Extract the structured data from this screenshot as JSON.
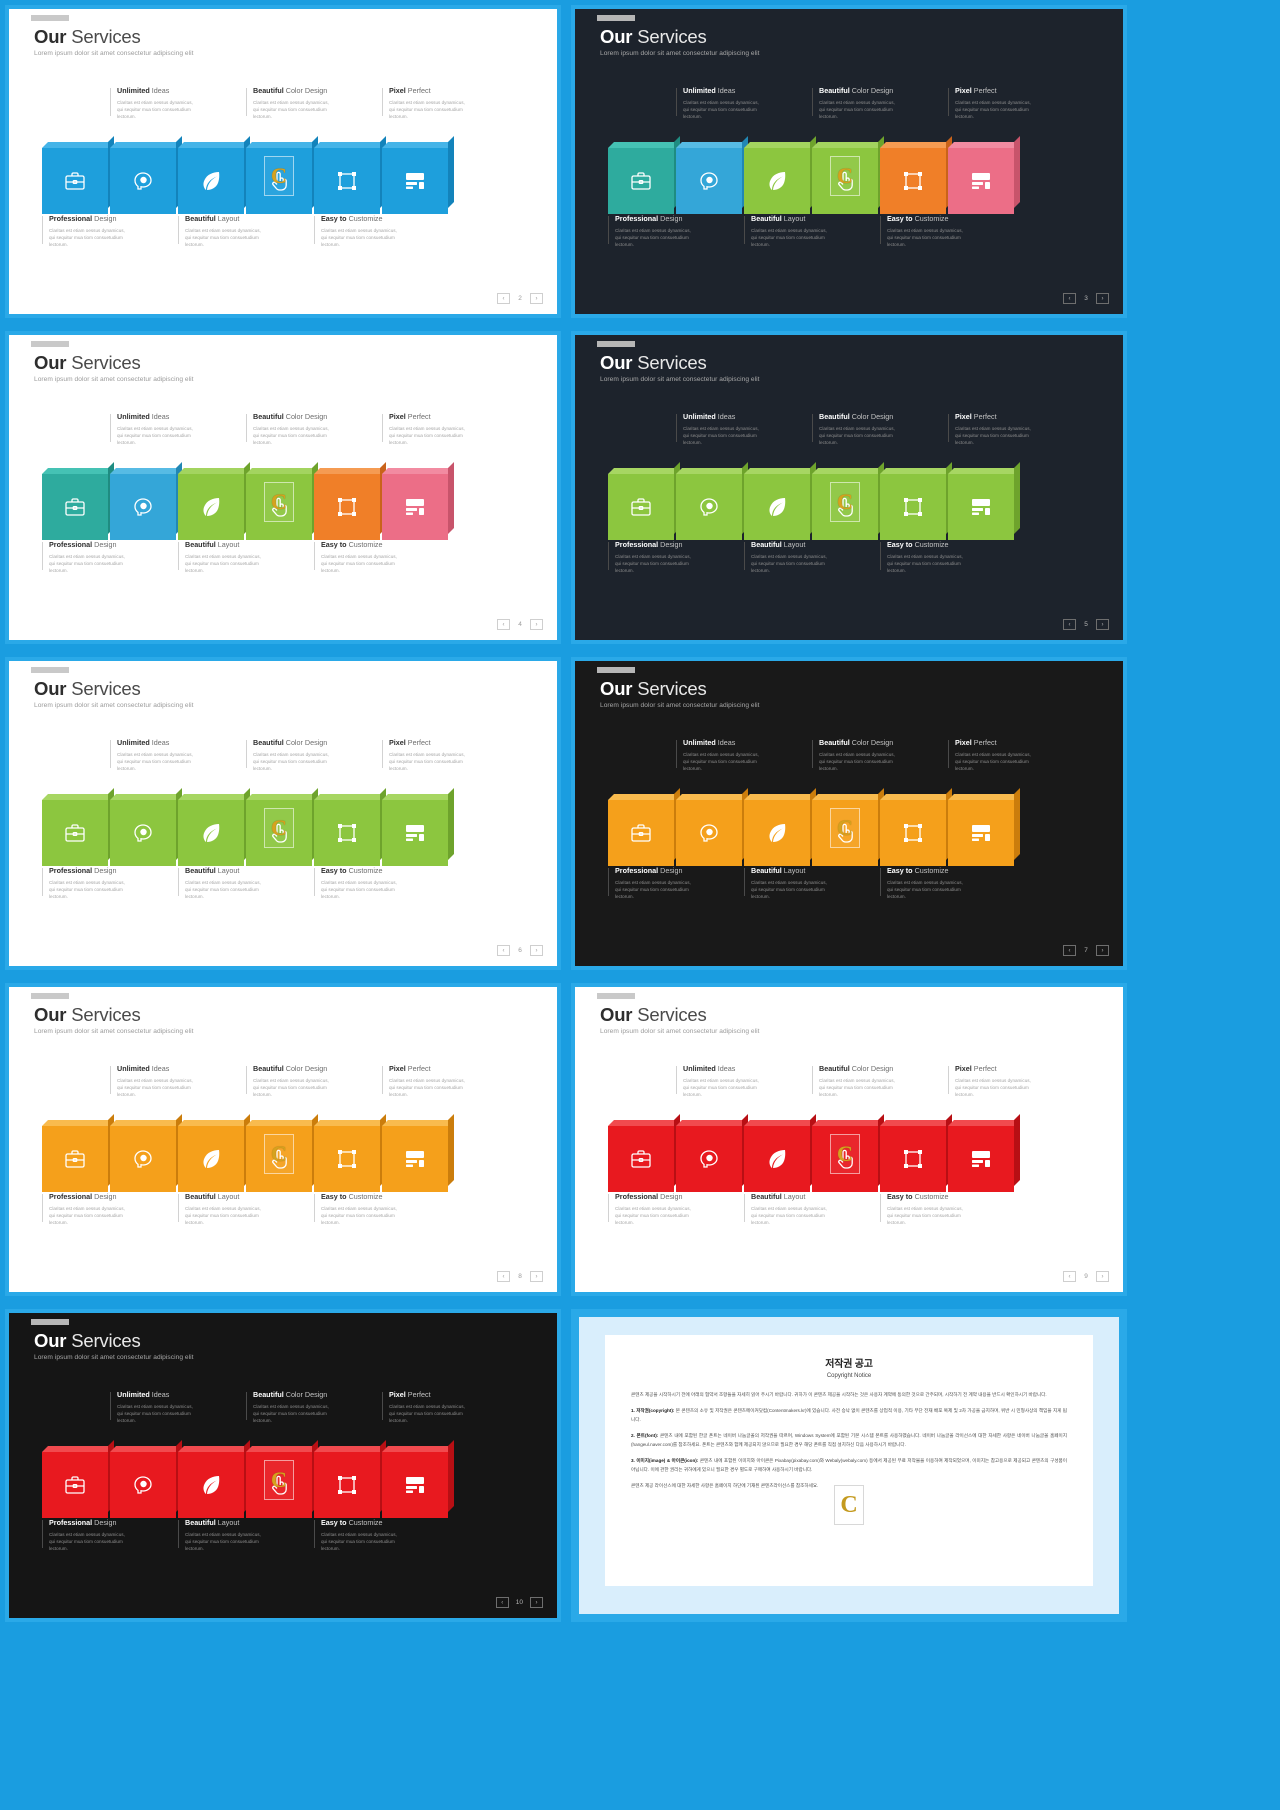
{
  "deck": {
    "title_bold": "Our",
    "title_rest": " Services",
    "subtitle": "Lorem ipsum dolor sit amet consectetur adipiscing elit",
    "body_text": "Claritas est etiam oessus dynamicus, qui sequitur mua tiom consuetudium lectorum.",
    "accent_frame": "#2aa9e8"
  },
  "labels": {
    "top": [
      {
        "bold": "Unlimited",
        "rest": " Ideas"
      },
      {
        "bold": "Beautiful",
        "rest": " Color Design"
      },
      {
        "bold": "Pixel",
        "rest": " Perfect"
      }
    ],
    "bottom": [
      {
        "bold": "Professional",
        "rest": " Design"
      },
      {
        "bold": "Beautiful",
        "rest": " Layout"
      },
      {
        "bold": "Easy to",
        "rest": " Customize"
      }
    ]
  },
  "icons": [
    "briefcase-icon",
    "head-bulb-icon",
    "leaf-icon",
    "hand-tap-icon",
    "crop-frame-icon",
    "server-icon"
  ],
  "watermark": {
    "letter": "C",
    "on_cube_index": 3
  },
  "pager": {
    "prev": "‹",
    "next": "›"
  },
  "slides": [
    {
      "name": "slide-blue-light",
      "theme": "light",
      "page": "2",
      "cube_colors": [
        "#1e9fdc",
        "#1e9fdc",
        "#1e9fdc",
        "#1e9fdc",
        "#1e9fdc",
        "#1e9fdc"
      ],
      "cube_tops": [
        "#45b4e8",
        "#45b4e8",
        "#45b4e8",
        "#45b4e8",
        "#45b4e8",
        "#45b4e8"
      ],
      "cube_sides": [
        "#1383bb",
        "#1383bb",
        "#1383bb",
        "#1383bb",
        "#1383bb",
        "#1383bb"
      ]
    },
    {
      "name": "slide-multicolor-dark",
      "theme": "dark",
      "page": "3",
      "cube_colors": [
        "#2eab9e",
        "#34a6d8",
        "#8cc63f",
        "#8cc63f",
        "#f07f28",
        "#ec6e87"
      ],
      "cube_tops": [
        "#45c2b4",
        "#57bbe4",
        "#a3d45f",
        "#a3d45f",
        "#f59b52",
        "#f28ba1"
      ],
      "cube_sides": [
        "#1f8c81",
        "#2287b4",
        "#6ea32c",
        "#6ea32c",
        "#c9631a",
        "#c8546b"
      ]
    },
    {
      "name": "slide-multicolor-light",
      "theme": "light",
      "page": "4",
      "cube_colors": [
        "#2eab9e",
        "#34a6d8",
        "#8cc63f",
        "#8cc63f",
        "#f07f28",
        "#ec6e87"
      ],
      "cube_tops": [
        "#45c2b4",
        "#57bbe4",
        "#a3d45f",
        "#a3d45f",
        "#f59b52",
        "#f28ba1"
      ],
      "cube_sides": [
        "#1f8c81",
        "#2287b4",
        "#6ea32c",
        "#6ea32c",
        "#c9631a",
        "#c8546b"
      ]
    },
    {
      "name": "slide-green-dark",
      "theme": "dark",
      "page": "5",
      "cube_colors": [
        "#8cc63f",
        "#8cc63f",
        "#8cc63f",
        "#8cc63f",
        "#8cc63f",
        "#8cc63f"
      ],
      "cube_tops": [
        "#a7d662",
        "#a7d662",
        "#a7d662",
        "#a7d662",
        "#a7d662",
        "#a7d662"
      ],
      "cube_sides": [
        "#6ea32c",
        "#6ea32c",
        "#6ea32c",
        "#6ea32c",
        "#6ea32c",
        "#6ea32c"
      ]
    },
    {
      "name": "slide-green-light",
      "theme": "light",
      "page": "6",
      "cube_colors": [
        "#8cc63f",
        "#8cc63f",
        "#8cc63f",
        "#8cc63f",
        "#8cc63f",
        "#8cc63f"
      ],
      "cube_tops": [
        "#a7d662",
        "#a7d662",
        "#a7d662",
        "#a7d662",
        "#a7d662",
        "#a7d662"
      ],
      "cube_sides": [
        "#6ea32c",
        "#6ea32c",
        "#6ea32c",
        "#6ea32c",
        "#6ea32c",
        "#6ea32c"
      ]
    },
    {
      "name": "slide-orange-dark",
      "theme": "darker",
      "page": "7",
      "cube_colors": [
        "#f5a01b",
        "#f5a01b",
        "#f5a01b",
        "#f5a01b",
        "#f5a01b",
        "#f5a01b"
      ],
      "cube_tops": [
        "#f9bb4e",
        "#f9bb4e",
        "#f9bb4e",
        "#f9bb4e",
        "#f9bb4e",
        "#f9bb4e"
      ],
      "cube_sides": [
        "#cb7d0c",
        "#cb7d0c",
        "#cb7d0c",
        "#cb7d0c",
        "#cb7d0c",
        "#cb7d0c"
      ]
    },
    {
      "name": "slide-orange-light",
      "theme": "light",
      "page": "8",
      "cube_colors": [
        "#f5a01b",
        "#f5a01b",
        "#f5a01b",
        "#f5a01b",
        "#f5a01b",
        "#f5a01b"
      ],
      "cube_tops": [
        "#f9bb4e",
        "#f9bb4e",
        "#f9bb4e",
        "#f9bb4e",
        "#f9bb4e",
        "#f9bb4e"
      ],
      "cube_sides": [
        "#cb7d0c",
        "#cb7d0c",
        "#cb7d0c",
        "#cb7d0c",
        "#cb7d0c",
        "#cb7d0c"
      ]
    },
    {
      "name": "slide-red-light",
      "theme": "light",
      "page": "9",
      "cube_colors": [
        "#e8191f",
        "#e8191f",
        "#e8191f",
        "#e8191f",
        "#e8191f",
        "#e8191f"
      ],
      "cube_tops": [
        "#f14a4e",
        "#f14a4e",
        "#f14a4e",
        "#f14a4e",
        "#f14a4e",
        "#f14a4e"
      ],
      "cube_sides": [
        "#b80f14",
        "#b80f14",
        "#b80f14",
        "#b80f14",
        "#b80f14",
        "#b80f14"
      ]
    },
    {
      "name": "slide-red-dark",
      "theme": "black",
      "page": "10",
      "cube_colors": [
        "#e8191f",
        "#e8191f",
        "#e8191f",
        "#e8191f",
        "#e8191f",
        "#e8191f"
      ],
      "cube_tops": [
        "#f14a4e",
        "#f14a4e",
        "#f14a4e",
        "#f14a4e",
        "#f14a4e",
        "#f14a4e"
      ],
      "cube_sides": [
        "#b80f14",
        "#b80f14",
        "#b80f14",
        "#b80f14",
        "#b80f14",
        "#b80f14"
      ]
    }
  ],
  "copyright": {
    "title": "저작권 공고",
    "subtitle": "Copyright Notice",
    "intro": "콘텐츠 제공을 시작하시기 전에 아래의 협약서 조항들을 자세히 읽어 주시기 바랍니다. 귀하가 이 콘텐츠 제공을 시작하는 것은 사용자 계약에 동의한 것으로 간주되며, 시작하기 전 계약 내용을 반드시 확인하시기 바랍니다.",
    "item1": "1. 저작권(copyright): 본 콘텐츠의 소유 및 저작권은 콘텐츠메이커닷컴(Contentmakers.kr)에 있습니다. 사전 승낙 없이 콘텐츠를 상업적 이용, 기타 무단 전재 배포 복제 및 2차 가공을 금지하며, 위반 시 민형사상의 책임을 지게 됩니다.",
    "item2": "2. 폰트(font): 콘텐츠 내에 포함된 한글 폰트는 네이버 나눔글꼴의 저작권을 따르며, Windows System에 포함된 기본 시스템 폰트를 사용하였습니다. 네이버 나눔글꼴 라이선스에 대한 자세한 사항은 네이버 나눔글꼴 홈페이지(hangeul.naver.com)를 참조하세요. 폰트는 콘텐츠와 함께 제공되지 않으므로 필요한 경우 해당 폰트를 직접 설치하신 다음 사용하시기 바랍니다.",
    "item3": "3. 이미지(image) & 아이콘(icon): 콘텐츠 내에 포함된 이미지와 아이콘은 Pixabay(pixabay.com)와 Webaly(webaly.com) 등에서 제공된 무료 저작물을 이용하여 제작되었으며, 이미지는 참고용으로 제공되고 콘텐츠의 구성품이 아닙니다. 이에 관한 권리는 귀하에게 있으니 필요한 경우 별도로 구매하여 사용하시기 바랍니다.",
    "footer": "콘텐츠 제공 라이선스에 대한 자세한 사항은 홈페이지 하단에 기재된 콘텐츠라이선스를 참조하세요.",
    "watermark_letter": "C"
  }
}
